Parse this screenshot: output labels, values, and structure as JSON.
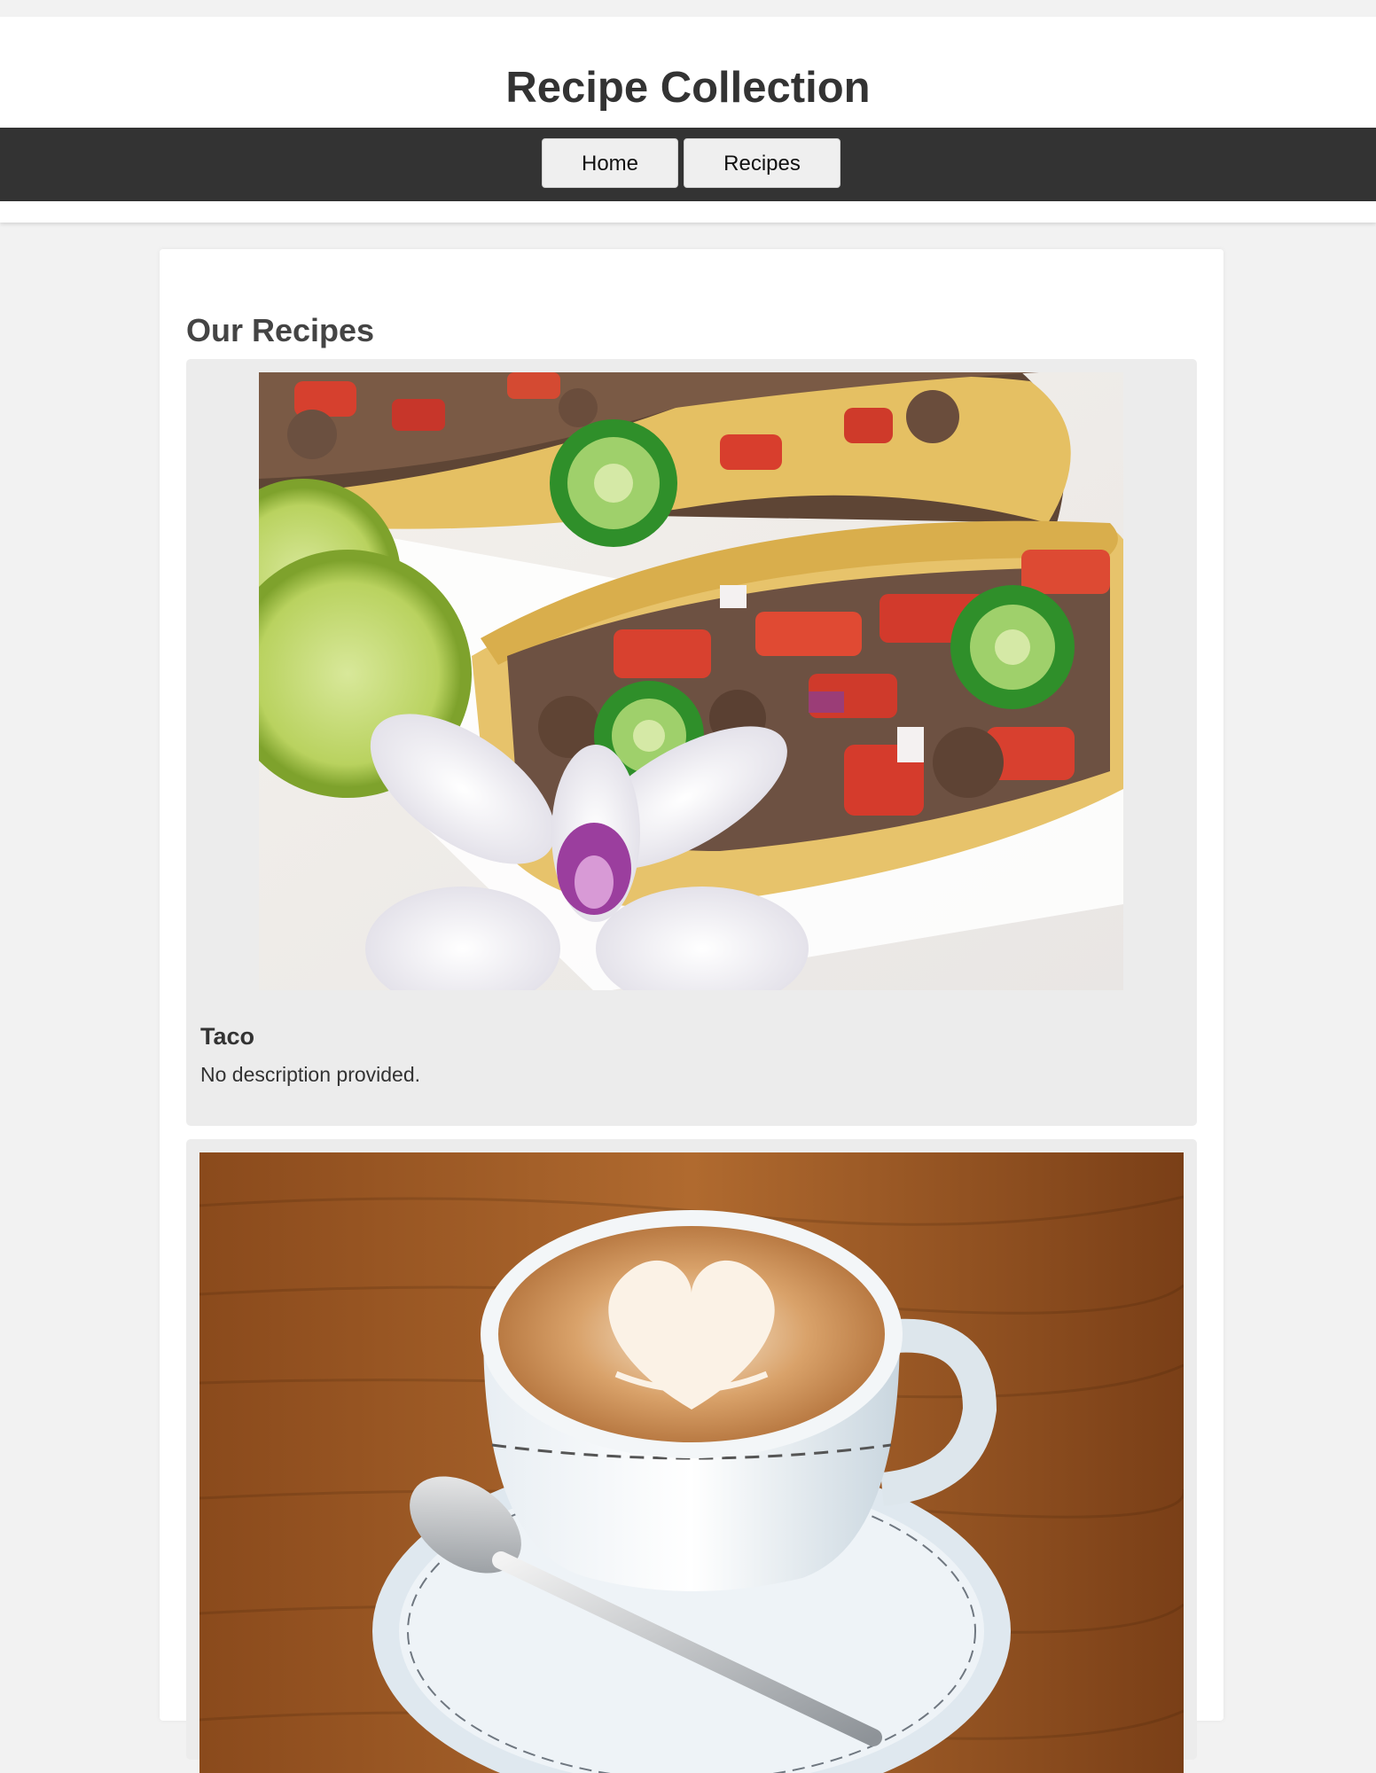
{
  "header": {
    "title": "Recipe Collection"
  },
  "nav": {
    "items": [
      {
        "label": "Home"
      },
      {
        "label": "Recipes"
      }
    ]
  },
  "main": {
    "section_title": "Our Recipes",
    "recipes": [
      {
        "name": "Taco",
        "description": "No description provided.",
        "image_icon": "taco-photo"
      },
      {
        "name": "",
        "description": "",
        "image_icon": "coffee-latte-photo"
      }
    ]
  },
  "colors": {
    "page_background": "#f2f2f2",
    "navbar": "#333333",
    "card_background": "#ffffff",
    "recipe_card_background": "#ececec"
  }
}
